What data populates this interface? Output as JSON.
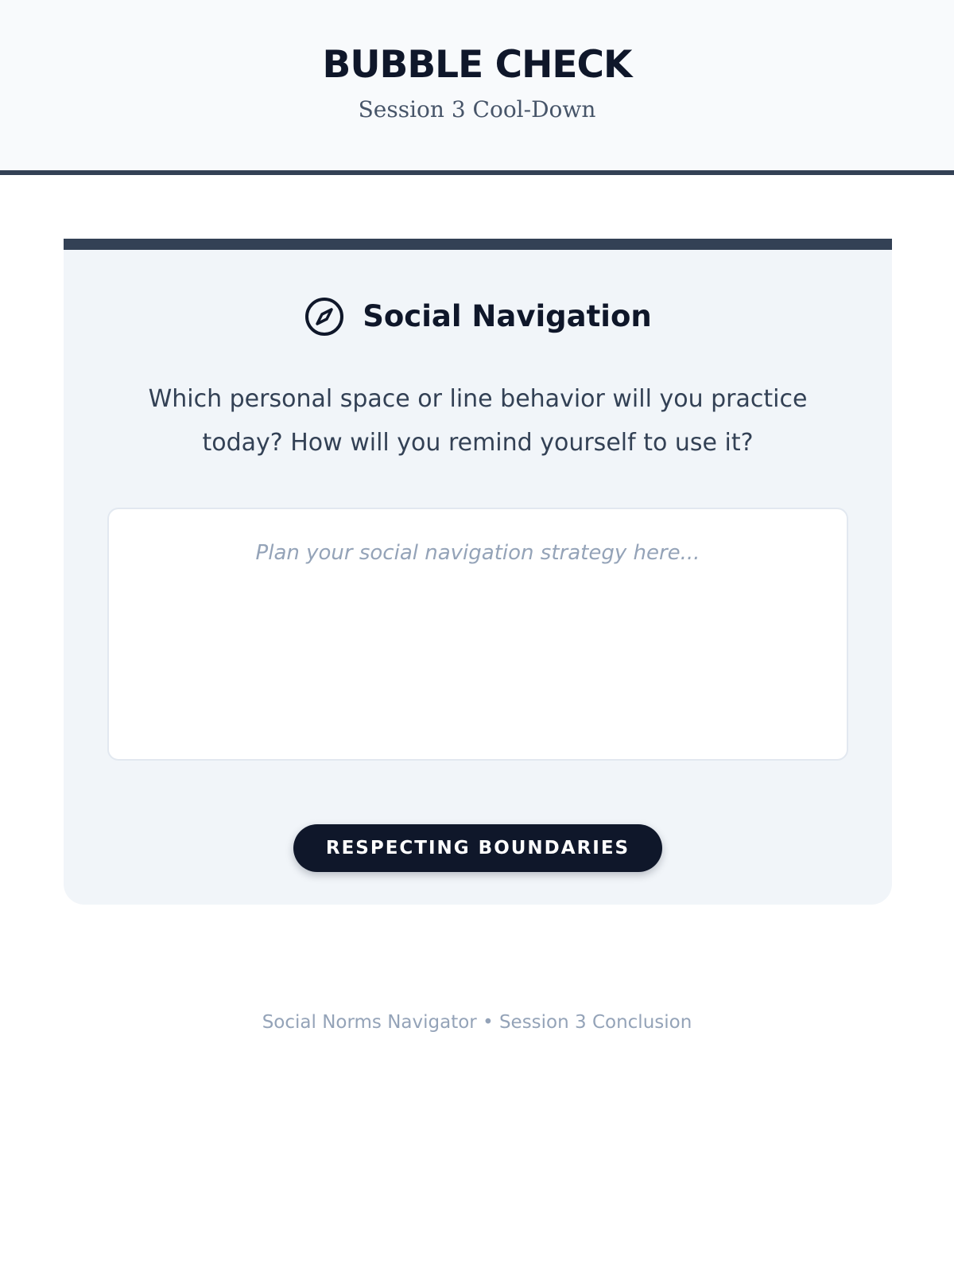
{
  "header": {
    "title": "BUBBLE CHECK",
    "subtitle": "Session 3 Cool-Down"
  },
  "card": {
    "icon": "compass-icon",
    "title": "Social Navigation",
    "prompt": "Which personal space or line behavior will you practice today? How will you remind yourself to use it?",
    "answer_value": "",
    "answer_placeholder": "Plan your social navigation strategy here...",
    "button_label": "RESPECTING BOUNDARIES"
  },
  "footer": {
    "text": "Social Norms Navigator • Session 3 Conclusion"
  },
  "colors": {
    "accent": "#334155",
    "primary_dark": "#0f172a",
    "header_bg": "#f8fafc",
    "card_bg": "#f1f5f9",
    "muted_text": "#94a3b8"
  }
}
